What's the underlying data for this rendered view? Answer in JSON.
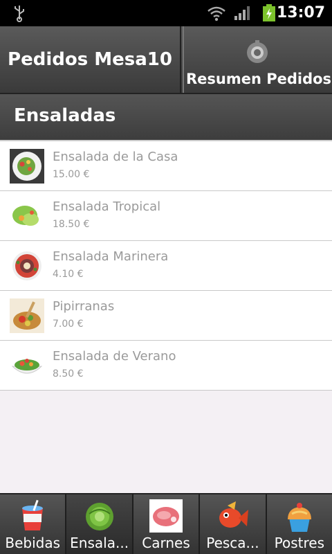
{
  "status_bar": {
    "time": "13:07"
  },
  "header": {
    "title": "Pedidos Mesa10",
    "summary_button": "Resumen Pedidos"
  },
  "section": {
    "title": "Ensaladas"
  },
  "items": [
    {
      "name": "Ensalada de la Casa",
      "price": "15.00 €"
    },
    {
      "name": "Ensalada Tropical",
      "price": "18.50 €"
    },
    {
      "name": "Ensalada Marinera",
      "price": "4.10 €"
    },
    {
      "name": "Pipirranas",
      "price": "7.00 €"
    },
    {
      "name": "Ensalada de Verano",
      "price": "8.50 €"
    }
  ],
  "tabs": [
    {
      "label": "Bebidas",
      "icon": "drink-cup-icon"
    },
    {
      "label": "Ensala...",
      "icon": "lettuce-icon",
      "selected": true
    },
    {
      "label": "Carnes",
      "icon": "meat-steak-icon"
    },
    {
      "label": "Pesca...",
      "icon": "fish-icon"
    },
    {
      "label": "Postres",
      "icon": "cupcake-icon"
    }
  ],
  "colors": {
    "header_bg": "#4a4a4a",
    "list_bg": "#ffffff",
    "empty_bg": "#f4f0f4",
    "item_text": "#9a9a9a"
  }
}
